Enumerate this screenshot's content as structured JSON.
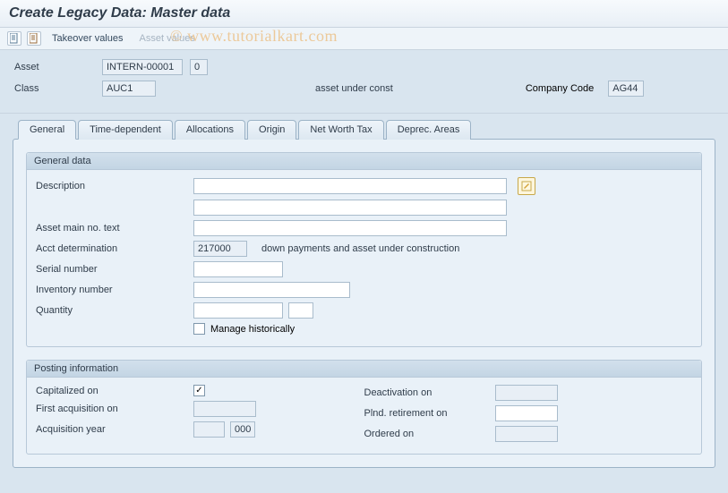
{
  "title": "Create Legacy Data: Master data",
  "watermark": "© www.tutorialkart.com",
  "toolbar": {
    "takeover_values": "Takeover values",
    "asset_values": "Asset values"
  },
  "header": {
    "asset_label": "Asset",
    "asset_value": "INTERN-00001",
    "asset_sub": "0",
    "class_label": "Class",
    "class_value": "AUC1",
    "class_desc": "asset under const",
    "company_code_label": "Company Code",
    "company_code_value": "AG44"
  },
  "tabs": [
    "General",
    "Time-dependent",
    "Allocations",
    "Origin",
    "Net Worth Tax",
    "Deprec. Areas"
  ],
  "general_data": {
    "group_title": "General data",
    "description_label": "Description",
    "description_value": "",
    "description_value2": "",
    "asset_main_text_label": "Asset main no. text",
    "asset_main_text_value": "",
    "acct_determination_label": "Acct determination",
    "acct_determination_value": "217000",
    "acct_determination_desc": "down payments and asset under construction",
    "serial_number_label": "Serial number",
    "serial_number_value": "",
    "inventory_number_label": "Inventory number",
    "inventory_number_value": "",
    "quantity_label": "Quantity",
    "quantity_value": "",
    "quantity_unit": "",
    "manage_historically_label": "Manage historically"
  },
  "posting_info": {
    "group_title": "Posting information",
    "capitalized_on_label": "Capitalized on",
    "capitalized_on_value": "",
    "first_acquisition_label": "First acquisition on",
    "first_acquisition_value": "",
    "acquisition_year_label": "Acquisition year",
    "acquisition_year_value": "",
    "acquisition_period_value": "000",
    "deactivation_on_label": "Deactivation on",
    "deactivation_on_value": "",
    "plnd_retirement_label": "Plnd. retirement on",
    "plnd_retirement_value": "",
    "ordered_on_label": "Ordered on",
    "ordered_on_value": ""
  }
}
